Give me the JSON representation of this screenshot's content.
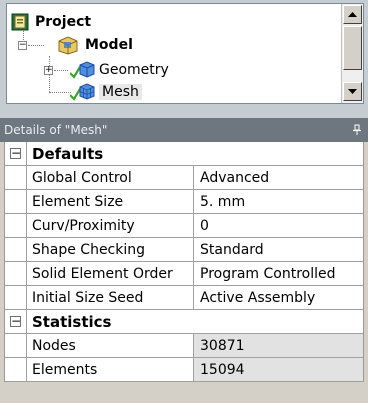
{
  "tree": {
    "items": [
      {
        "label": "Project",
        "icon": "project-icon"
      },
      {
        "label": "Model",
        "icon": "model-icon"
      },
      {
        "label": "Geometry",
        "icon": "geometry-icon"
      },
      {
        "label": "Mesh",
        "icon": "mesh-icon"
      }
    ]
  },
  "details": {
    "title": "Details of \"Mesh\"",
    "pin_glyph": "q",
    "groups": [
      {
        "title": "Defaults",
        "rows": [
          {
            "name": "Global Control",
            "value": "Advanced"
          },
          {
            "name": "Element Size",
            "value": "5. mm"
          },
          {
            "name": "Curv/Proximity",
            "value": "0"
          },
          {
            "name": "Shape Checking",
            "value": "Standard"
          },
          {
            "name": "Solid Element Order",
            "value": "Program Controlled"
          },
          {
            "name": "Initial Size Seed",
            "value": "Active Assembly"
          }
        ]
      },
      {
        "title": "Statistics",
        "rows": [
          {
            "name": "Nodes",
            "value": "30871"
          },
          {
            "name": "Elements",
            "value": "15094"
          }
        ]
      }
    ]
  },
  "colors": {
    "header_bg": "#6e7780",
    "check_green": "#3aa62b",
    "cube_blue": "#2a6fd6"
  }
}
